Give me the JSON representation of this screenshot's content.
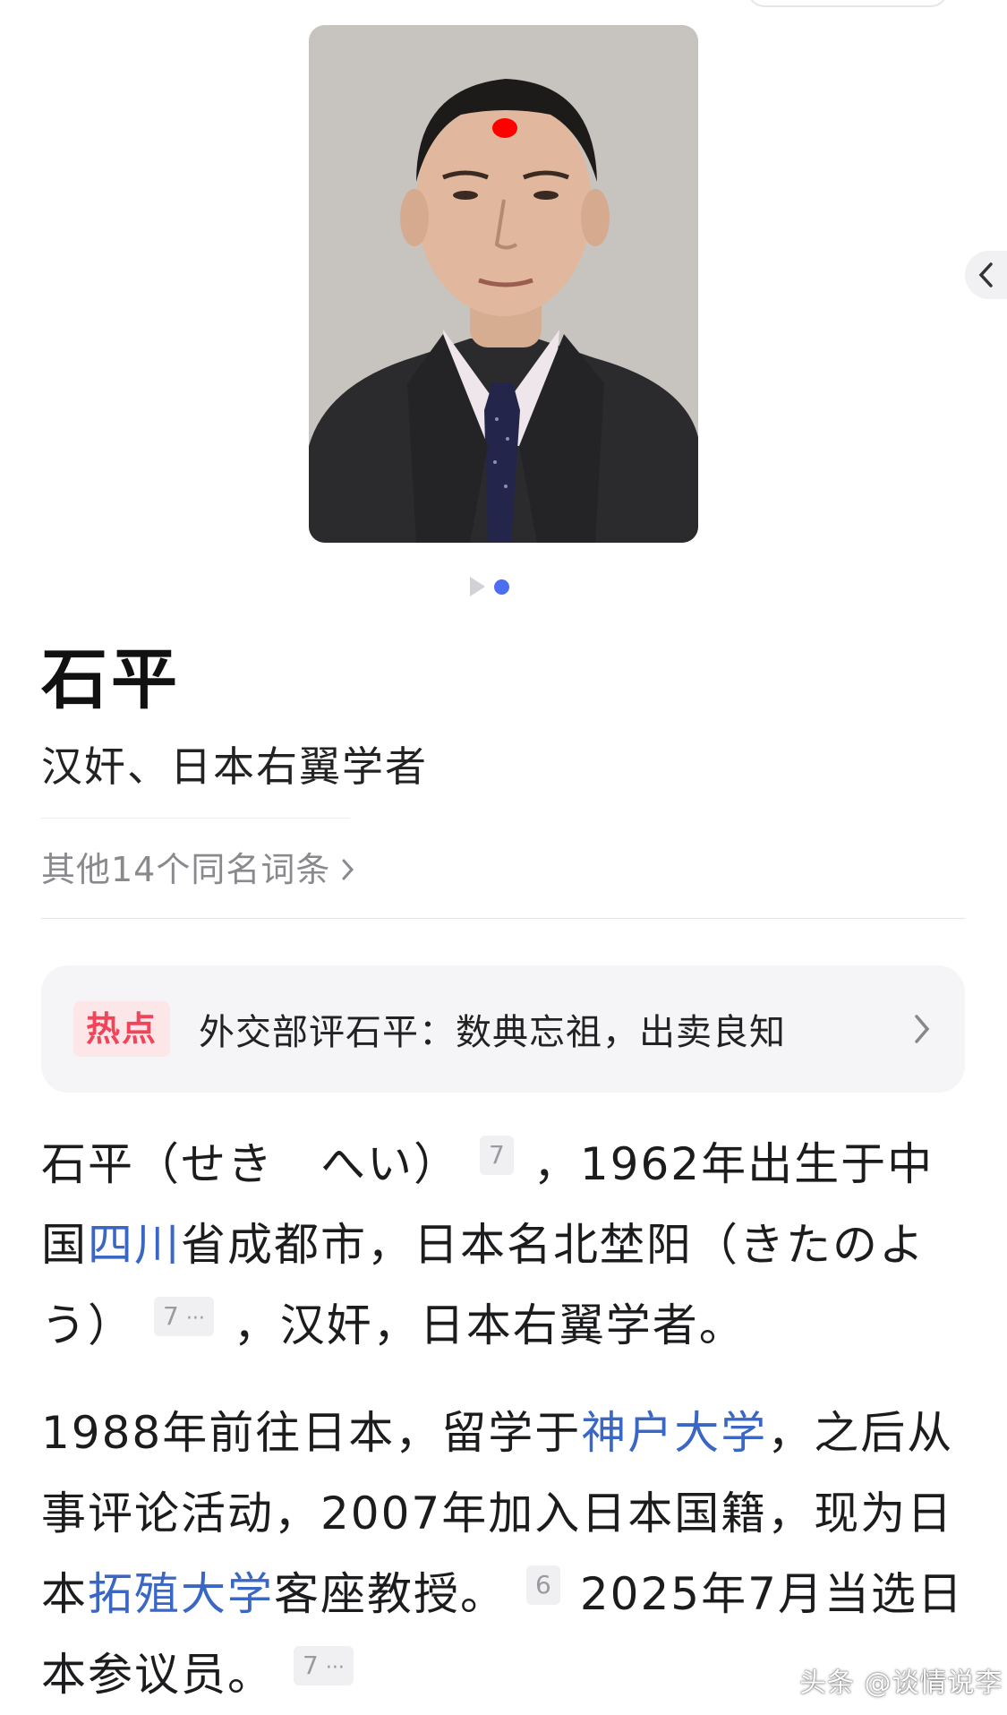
{
  "gallery": {
    "pages": 2,
    "active_page": 2
  },
  "entry": {
    "title": "石平",
    "subtitle": "汉奸、日本右翼学者",
    "other_entries": "其他14个同名词条"
  },
  "hot": {
    "badge": "热点",
    "headline": "外交部评石平：数典忘祖，出卖良知"
  },
  "paragraph1": {
    "part1": "石平（せき　へい）",
    "ref1": "7",
    "part2": "，1962年出生于中国",
    "link1": "四川",
    "part3": "省成都市，日本名北埜阳（きたのよう）",
    "ref2": "7",
    "ref2_more": "···",
    "part4": "，汉奸，日本右翼学者。"
  },
  "paragraph2": {
    "part1": "1988年前往日本，留学于",
    "link1": "神户大学",
    "part2": "，之后从事评论活动，2007年加入日本国籍，现为日本",
    "link2": "拓殖大学",
    "part3": "客座教授。",
    "ref1": "6",
    "part4": "2025年7月当选日本参议员。",
    "ref2": "7",
    "ref2_more": "···"
  },
  "watermark": "头条 @谈情说李",
  "colors": {
    "link": "#3a66c4",
    "hot_badge_text": "#f0445a",
    "hot_badge_bg": "#fde6e8",
    "pager_active": "#4e6ef2"
  }
}
